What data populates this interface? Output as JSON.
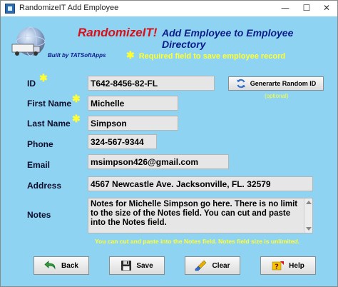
{
  "window": {
    "title": "RandomizeIT Add Employee",
    "controls": {
      "minimize": "—",
      "maximize": "☐",
      "close": "✕"
    }
  },
  "header": {
    "brand": "RandomizeIT!",
    "headline": "Add Employee to Employee Directory",
    "built_by": "Built by TATSoftApps",
    "required_star": "✱",
    "required_note": "Required field to save employee record"
  },
  "form": {
    "id": {
      "label": "ID",
      "value": "T642-8456-82-FL",
      "required": "✱"
    },
    "first_name": {
      "label": "First Name",
      "value": "Michelle",
      "required": "✱"
    },
    "last_name": {
      "label": "Last Name",
      "value": "Simpson",
      "required": "✱"
    },
    "phone": {
      "label": "Phone",
      "value": "324-567-9344"
    },
    "email": {
      "label": "Email",
      "value": "msimpson426@gmail.com"
    },
    "address": {
      "label": "Address",
      "value": "4567 Newcastle Ave. Jacksonville, FL. 32579"
    },
    "notes": {
      "label": "Notes",
      "value": "Notes for Michelle Simpson go here. There is no limit to the size of the Notes field. You can cut and paste into the Notes field.",
      "hint": "You can cut and paste into the Notes field. Notes field size is unlimited."
    },
    "generate_button": "Generarte Random ID",
    "optional_note": "(optional)"
  },
  "actions": {
    "back": "Back",
    "save": "Save",
    "clear": "Clear",
    "help": "Help"
  },
  "colors": {
    "background": "#8fd3f2",
    "brand": "#d8101a",
    "headline": "#0b1d8a",
    "required": "#ffff33",
    "field": "#e6e6e6"
  }
}
